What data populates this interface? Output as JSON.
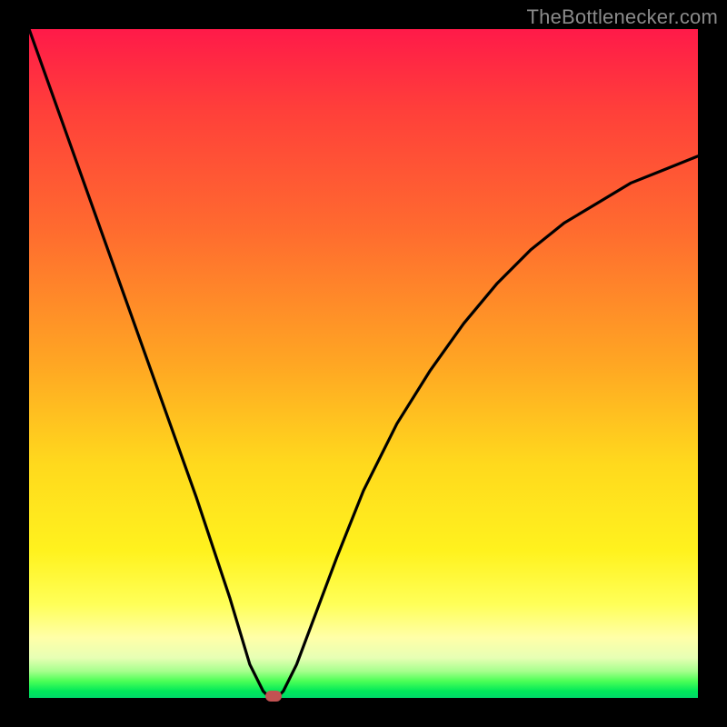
{
  "watermark": "TheBottlenecker.com",
  "marker": {
    "name": "bottleneck-marker",
    "color": "#c25252"
  },
  "chart_data": {
    "type": "line",
    "title": "",
    "xlabel": "",
    "ylabel": "",
    "xlim": [
      0,
      100
    ],
    "ylim": [
      0,
      100
    ],
    "background_gradient": {
      "top_color": "#ff1a49",
      "bottom_color": "#00d96a",
      "meaning": "red=high bottleneck, green=low bottleneck"
    },
    "series": [
      {
        "name": "bottleneck-curve",
        "x": [
          0,
          5,
          10,
          15,
          20,
          25,
          30,
          33,
          35,
          36,
          37,
          38,
          40,
          43,
          46,
          50,
          55,
          60,
          65,
          70,
          75,
          80,
          85,
          90,
          95,
          100
        ],
        "y": [
          100,
          86,
          72,
          58,
          44,
          30,
          15,
          5,
          1,
          0,
          0,
          1,
          5,
          13,
          21,
          31,
          41,
          49,
          56,
          62,
          67,
          71,
          74,
          77,
          79,
          81
        ]
      }
    ],
    "optimal_point": {
      "x": 36.5,
      "y": 0
    }
  }
}
